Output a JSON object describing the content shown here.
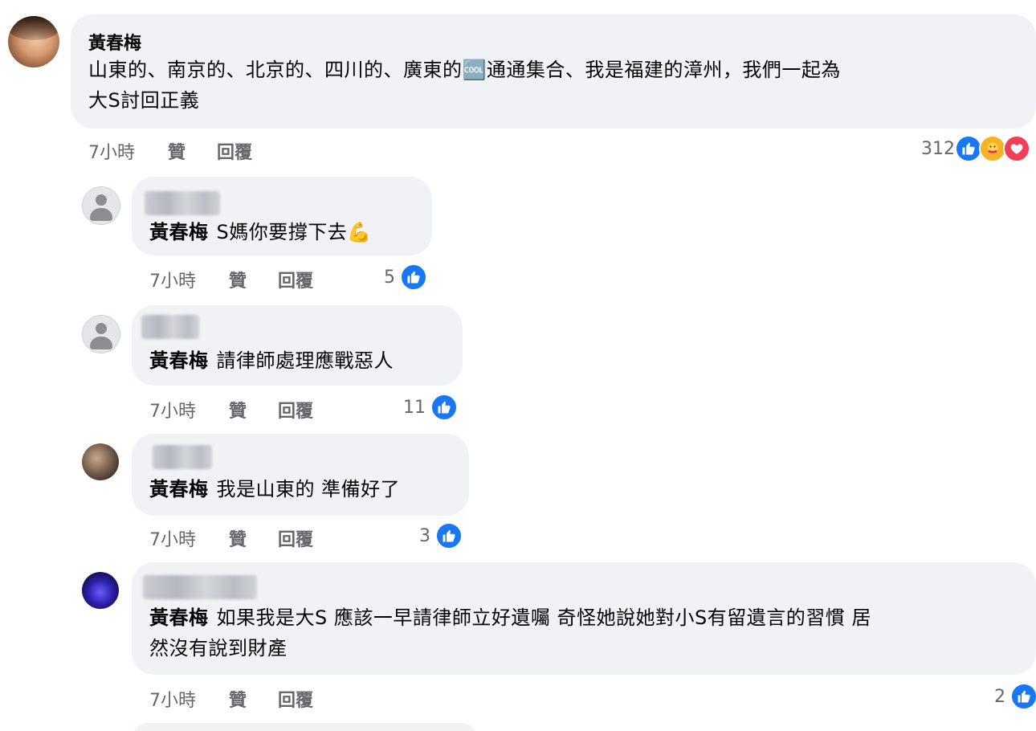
{
  "main_comment": {
    "author": "黃春梅",
    "text_line1": "山東的、南京的、北京的、四川的、廣東的🆒通通集合、我是福建的漳州，我們一起為",
    "text_line2": "大S討回正義",
    "time": "7小時",
    "like_label": "贊",
    "reply_label": "回覆",
    "reaction_count": "312",
    "reactions": [
      "like-icon",
      "care-icon",
      "love-icon"
    ]
  },
  "replies": [
    {
      "tag": "黃春梅",
      "text": "S媽你要撐下去💪",
      "time": "7小時",
      "like_label": "贊",
      "reply_label": "回覆",
      "reaction_count": "5"
    },
    {
      "tag": "黃春梅",
      "text": "請律師處理應戰惡人",
      "time": "7小時",
      "like_label": "贊",
      "reply_label": "回覆",
      "reaction_count": "11"
    },
    {
      "tag": "黃春梅",
      "text": "我是山東的 準備好了",
      "time": "7小時",
      "like_label": "贊",
      "reply_label": "回覆",
      "reaction_count": "3"
    },
    {
      "tag": "黃春梅",
      "text_line1": "如果我是大S 應該一早請律師立好遺囑 奇怪她說她對小S有留遺言的習慣 居",
      "text_line2": "然沒有說到財產",
      "time": "7小時",
      "like_label": "贊",
      "reply_label": "回覆",
      "reaction_count": "2"
    }
  ],
  "colors": {
    "bubble": "#f0f2f5",
    "meta_text": "#65676b",
    "like_blue": "#1877f2",
    "care_yellow": "#f7b125",
    "love_red": "#f33e58"
  }
}
